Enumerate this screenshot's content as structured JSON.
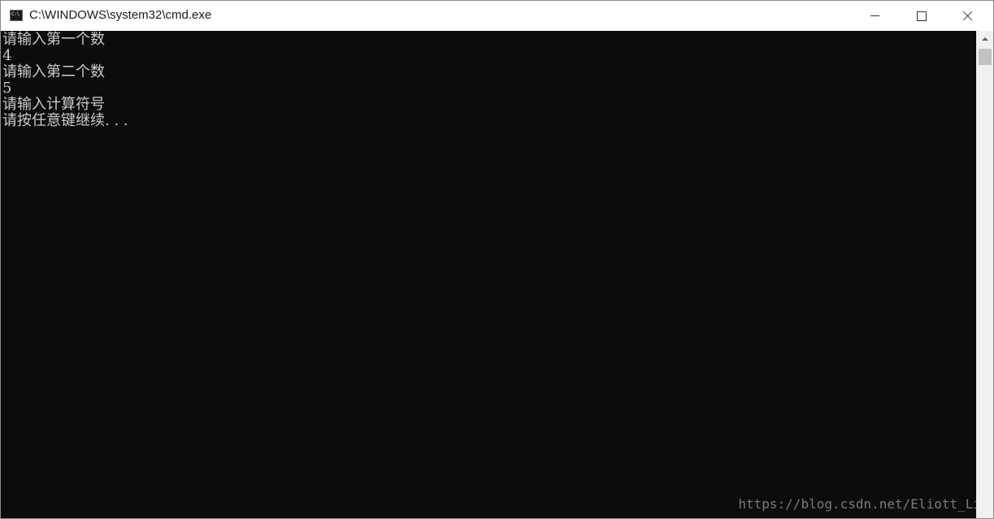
{
  "window": {
    "title": "C:\\WINDOWS\\system32\\cmd.exe",
    "icon_text": "C:\\",
    "icon": "cmd-icon"
  },
  "caption_buttons": {
    "minimize": "minimize-icon",
    "maximize": "maximize-icon",
    "close": "close-icon"
  },
  "console": {
    "lines": [
      "请输入第一个数",
      "4",
      "请输入第二个数",
      "5",
      "请输入计算符号",
      "请按任意键继续. . ."
    ],
    "background": "#0c0c0c",
    "foreground": "#cccccc"
  },
  "watermark": "https://blog.csdn.net/Eliott_Li"
}
